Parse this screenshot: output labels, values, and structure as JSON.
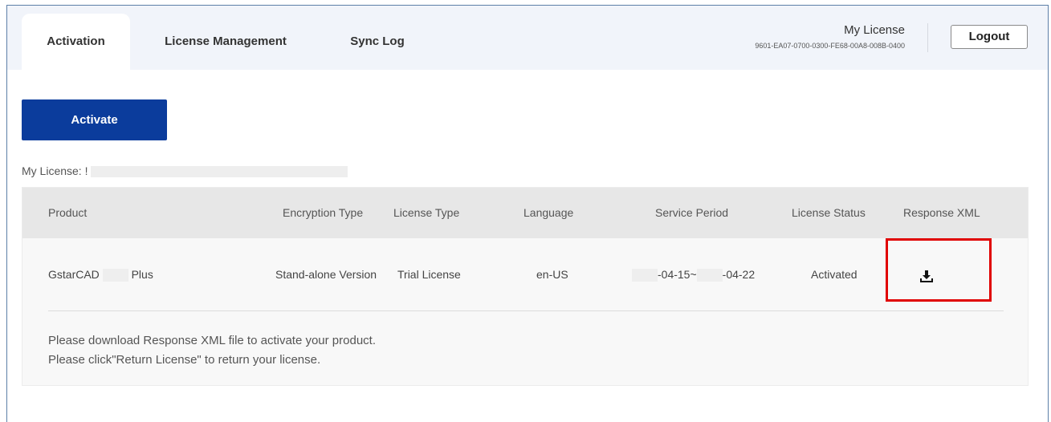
{
  "header": {
    "tabs": [
      {
        "label": "Activation",
        "active": true
      },
      {
        "label": "License Management",
        "active": false
      },
      {
        "label": "Sync Log",
        "active": false
      }
    ],
    "license_title": "My License",
    "license_key": "9601-EA07-0700-0300-FE68-00A8-008B-0400",
    "logout_label": "Logout"
  },
  "main": {
    "activate_label": "Activate",
    "my_license_label": "My License: !"
  },
  "table": {
    "columns": [
      "Product",
      "Encryption Type",
      "License Type",
      "Language",
      "Service Period",
      "License Status",
      "Response XML"
    ],
    "rows": [
      {
        "product_prefix": "GstarCAD",
        "product_suffix": "Plus",
        "encryption_type": "Stand-alone Version",
        "license_type": "Trial License",
        "language": "en-US",
        "period_start": "-04-15~",
        "period_end": "-04-22",
        "status": "Activated",
        "response_xml_icon": "download-icon"
      }
    ],
    "notes": [
      "Please download Response XML file to activate your product.",
      "Please click\"Return License\" to return your license."
    ]
  },
  "colors": {
    "primary": "#0b3c9c",
    "highlight": "#e00000",
    "header_bg": "#f1f4fa"
  }
}
